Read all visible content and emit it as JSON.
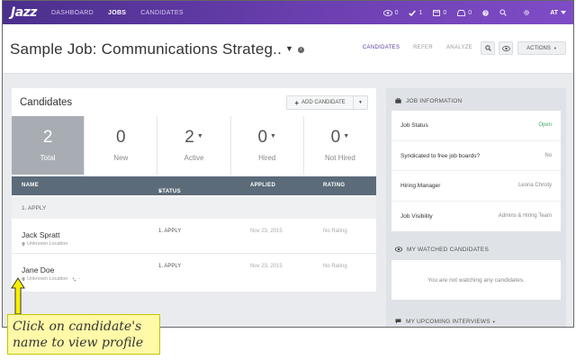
{
  "colors": {
    "brand_purple": "#5b3c9e",
    "nav_gradient_start": "#4a2f8c",
    "nav_gradient_end": "#7f4cc7",
    "open_green": "#3fae6a",
    "table_header": "#5c6b7a",
    "callout_yellow": "#fff9a8",
    "arrow_yellow": "#f7f000"
  },
  "nav": {
    "logo": "Jazz",
    "links": [
      "DASHBOARD",
      "JOBS",
      "CANDIDATES"
    ],
    "active_link": "JOBS",
    "counters": {
      "eye": "0",
      "check": "1",
      "calendar": "0",
      "inbox": "0"
    },
    "user": "AT"
  },
  "header": {
    "title": "Sample Job: Communications Strateg..",
    "tabs": [
      "CANDIDATES",
      "REFER",
      "ANALYZE"
    ],
    "actions_label": "ACTIONS"
  },
  "candidates_card": {
    "title": "Candidates",
    "add_button": "ADD CANDIDATE",
    "stats": [
      {
        "value": "2",
        "label": "Total"
      },
      {
        "value": "0",
        "label": "New"
      },
      {
        "value": "2",
        "label": "Active"
      },
      {
        "value": "0",
        "label": "Hired"
      },
      {
        "value": "0",
        "label": "Not Hired"
      }
    ],
    "columns": [
      "NAME",
      "STATUS",
      "APPLIED",
      "RATING"
    ],
    "group": "1. APPLY",
    "rows": [
      {
        "name": "Jack Spratt",
        "location": "Unknown Location",
        "status": "1. APPLY",
        "applied": "Nov 23, 2015",
        "rating": "No Rating"
      },
      {
        "name": "Jane Doe",
        "location": "Unknown Location",
        "status": "1. APPLY",
        "applied": "Nov 23, 2015",
        "rating": "No Rating"
      }
    ]
  },
  "sidebar": {
    "job_info_title": "JOB INFORMATION",
    "job_info": [
      {
        "key": "Job Status",
        "value": "Open"
      },
      {
        "key": "Syndicated to free job boards?",
        "value": "No"
      },
      {
        "key": "Hiring Manager",
        "value": "Leona Christy"
      },
      {
        "key": "Job Visibility",
        "value": "Admins & Hiring Team"
      }
    ],
    "watched_title": "MY WATCHED CANDIDATES",
    "watched_empty": "You are not watching any candidates.",
    "interviews_title": "MY UPCOMING INTERVIEWS"
  },
  "callout": {
    "line1": "Click on candidate's",
    "line2": "name to view profile"
  }
}
